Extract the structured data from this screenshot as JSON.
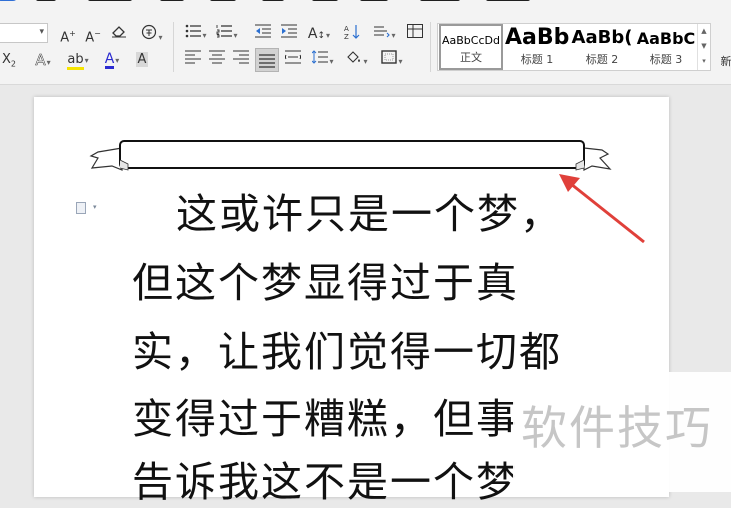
{
  "toolbar": {
    "styles": [
      {
        "preview": "AaBbCcDd",
        "caption": "正文"
      },
      {
        "preview": "AaBb",
        "caption": "标题 1"
      },
      {
        "preview": "AaBb(",
        "caption": "标题 2"
      },
      {
        "preview": "AaBbC",
        "caption": "标题 3"
      }
    ],
    "new_style_label": "新"
  },
  "document": {
    "lines": [
      "这或许只是一个梦，",
      "但这个梦显得过于真",
      "实，让我们觉得一切都",
      "变得过于糟糕，但事",
      "告诉我这不是一个梦"
    ]
  },
  "annotation": {
    "arrow_color": "#e0403a"
  },
  "watermark": {
    "text": "软件技巧"
  }
}
